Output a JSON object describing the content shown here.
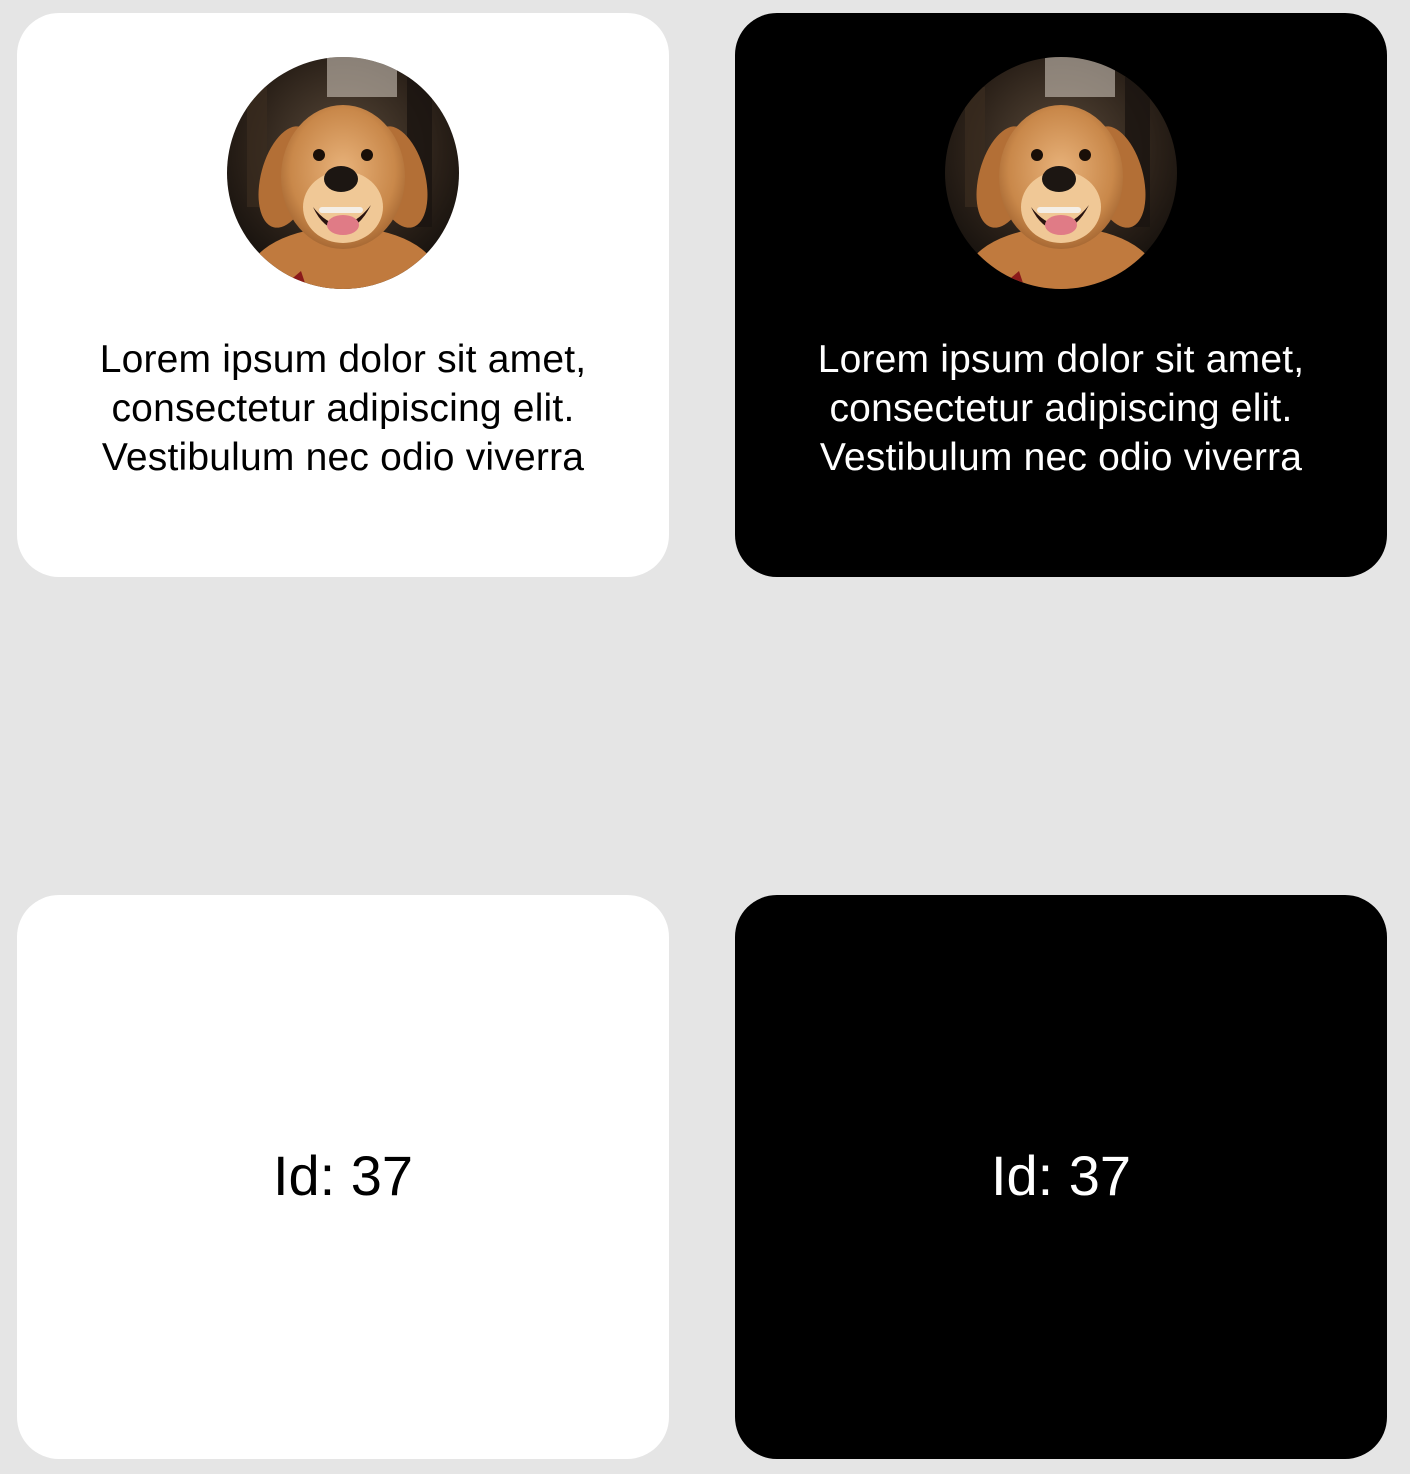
{
  "cards": [
    {
      "theme": "light",
      "image": "golden-retriever-photo",
      "text": "Lorem ipsum dolor sit amet, consectetur adipiscing elit. Vestibulum nec odio viverra"
    },
    {
      "theme": "dark",
      "image": "golden-retriever-photo",
      "text": "Lorem ipsum dolor sit amet, consectetur adipiscing elit. Vestibulum nec odio viverra"
    },
    {
      "theme": "light",
      "text": "Id: 37"
    },
    {
      "theme": "dark",
      "text": "Id: 37"
    }
  ],
  "colors": {
    "page_background": "#e5e5e5",
    "light_card": "#ffffff",
    "dark_card": "#000000"
  }
}
